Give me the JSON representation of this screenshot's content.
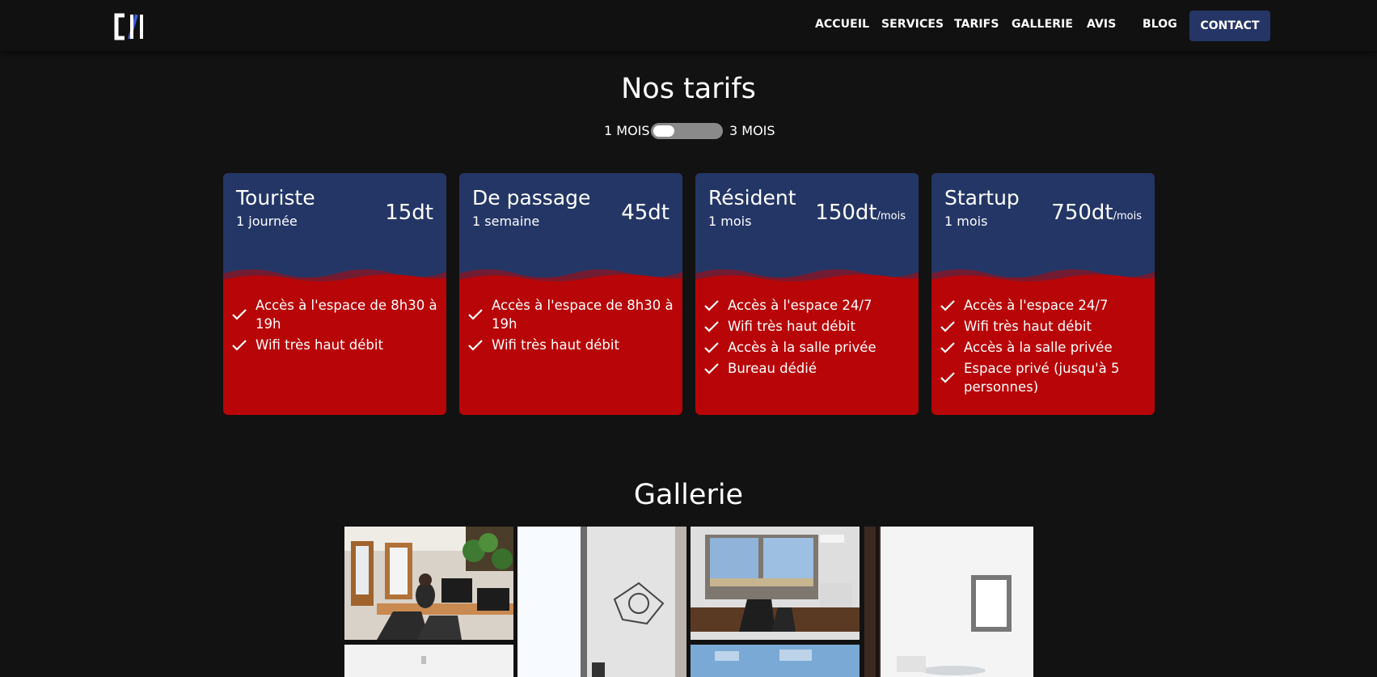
{
  "header": {
    "logo_text": "C/H",
    "nav": [
      "ACCUEIL",
      "SERVICES",
      "TARIFS",
      "GALLERIE",
      "AVIS",
      "BLOG"
    ],
    "contact": "CONTACT"
  },
  "tarifs": {
    "title": "Nos tarifs",
    "toggle_left": "1 MOIS",
    "toggle_right": "3 MOIS",
    "toggle_state": "1 MOIS",
    "plans": [
      {
        "name": "Touriste",
        "period": "1 journée",
        "price": "15dt",
        "unit": "",
        "features": [
          "Accès à l'espace de 8h30 à 19h",
          "Wifi très haut débit"
        ]
      },
      {
        "name": "De passage",
        "period": "1 semaine",
        "price": "45dt",
        "unit": "",
        "features": [
          "Accès à l'espace de 8h30 à 19h",
          "Wifi très haut débit"
        ]
      },
      {
        "name": "Résident",
        "period": "1 mois",
        "price": "150dt",
        "unit": "/mois",
        "features": [
          "Accès à l'espace 24/7",
          "Wifi très haut débit",
          "Accès à la salle privée",
          "Bureau dédié"
        ]
      },
      {
        "name": "Startup",
        "period": "1 mois",
        "price": "750dt",
        "unit": "/mois",
        "features": [
          "Accès à l'espace 24/7",
          "Wifi très haut débit",
          "Accès à la salle privée",
          "Espace privé (jusqu'à 5 personnes)"
        ]
      }
    ],
    "colors": {
      "card_top": "#243666",
      "card_bottom": "#b80508",
      "accent": "#253566"
    }
  },
  "gallery": {
    "title": "Gallerie",
    "photos": [
      "office-desks-photo",
      "hallway-door-photo",
      "workspace-window-photo",
      "white-room-photo",
      "white-wall-photo",
      "skylight-room-photo"
    ]
  }
}
